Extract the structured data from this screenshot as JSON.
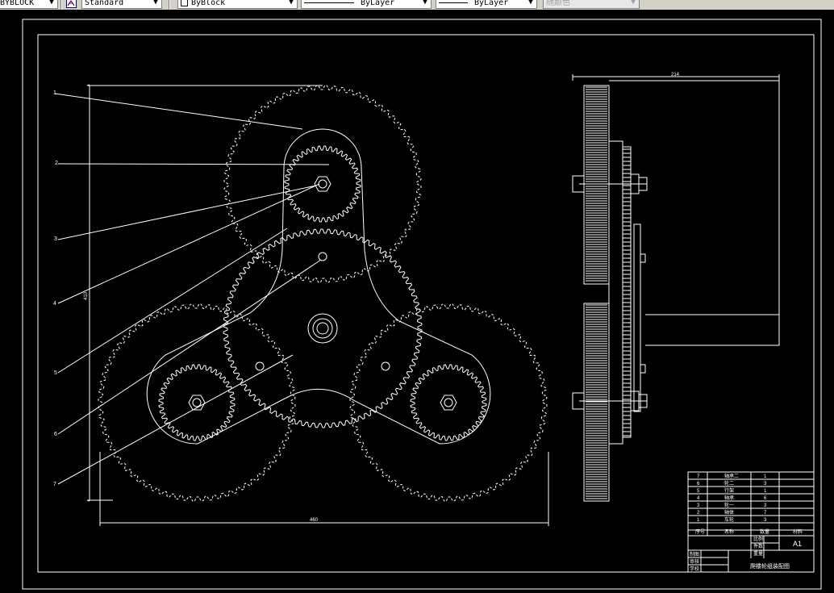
{
  "toolbar": {
    "layer_value": "BYBLOCK",
    "text_style_value": "Standard",
    "color_value": "ByBlock",
    "linetype_value": "ByLayer",
    "lineweight_value": "ByLayer",
    "plotstyle_value": "随颜色"
  },
  "drawing": {
    "background": "#000000",
    "line_color": "#ffffff",
    "callouts": [
      "1",
      "2",
      "3",
      "4",
      "5",
      "6",
      "7"
    ],
    "dim_width": "460",
    "dim_height": "410",
    "dim_side_width": "214"
  },
  "title_block": {
    "parts": [
      {
        "no": "7",
        "name": "轴承二",
        "qty": "1"
      },
      {
        "no": "6",
        "name": "轮二",
        "qty": "3"
      },
      {
        "no": "5",
        "name": "行架",
        "qty": "1"
      },
      {
        "no": "4",
        "name": "轴承",
        "qty": "6"
      },
      {
        "no": "3",
        "name": "轮一",
        "qty": "3"
      },
      {
        "no": "2",
        "name": "轴体",
        "qty": "7"
      },
      {
        "no": "1",
        "name": "车轮",
        "qty": "3"
      }
    ],
    "headers": [
      "序号",
      "名称",
      "数量",
      "材料"
    ],
    "ratio_label": "比例",
    "quantity_label": "件数",
    "weight_label": "重量",
    "sheet_size": "A1",
    "designed_label": "制图",
    "checked_label": "审核",
    "school_label": "学校",
    "drawing_title": "爬楼轮组装配图"
  }
}
